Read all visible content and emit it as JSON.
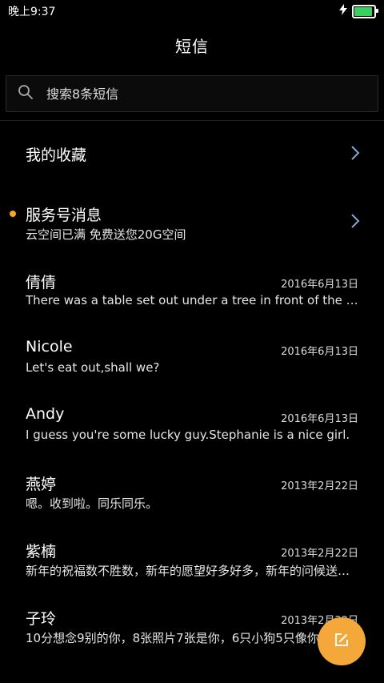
{
  "status": {
    "time": "晚上9:37"
  },
  "header": {
    "title": "短信"
  },
  "search": {
    "placeholder": "搜索8条短信"
  },
  "favorites": {
    "label": "我的收藏"
  },
  "service": {
    "name": "服务号消息",
    "preview": "云空间已满 免费送您20G空间"
  },
  "messages": [
    {
      "name": "倩倩",
      "date": "2016年6月13日",
      "preview": "There was a table set out under a tree in front of the house"
    },
    {
      "name": "Nicole",
      "date": "2016年6月13日",
      "preview": "Let's eat out,shall we?"
    },
    {
      "name": "Andy",
      "date": "2016年6月13日",
      "preview": "I guess you're some lucky guy.Stephanie is a nice girl."
    },
    {
      "name": "燕婷",
      "date": "2013年2月22日",
      "preview": "嗯。收到啦。同乐同乐。"
    },
    {
      "name": "紫楠",
      "date": "2013年2月22日",
      "preview": "新年的祝福数不胜数，新年的愿望好多好多，新年的问候送给你"
    },
    {
      "name": "子玲",
      "date": "2013年2月22日",
      "preview": "10分想念9别的你，8张照片7张是你，6只小狗5只像你"
    }
  ],
  "colors": {
    "accent": "#f5a83a",
    "chevron": "#7fa8d6",
    "battery": "#37d15f"
  }
}
